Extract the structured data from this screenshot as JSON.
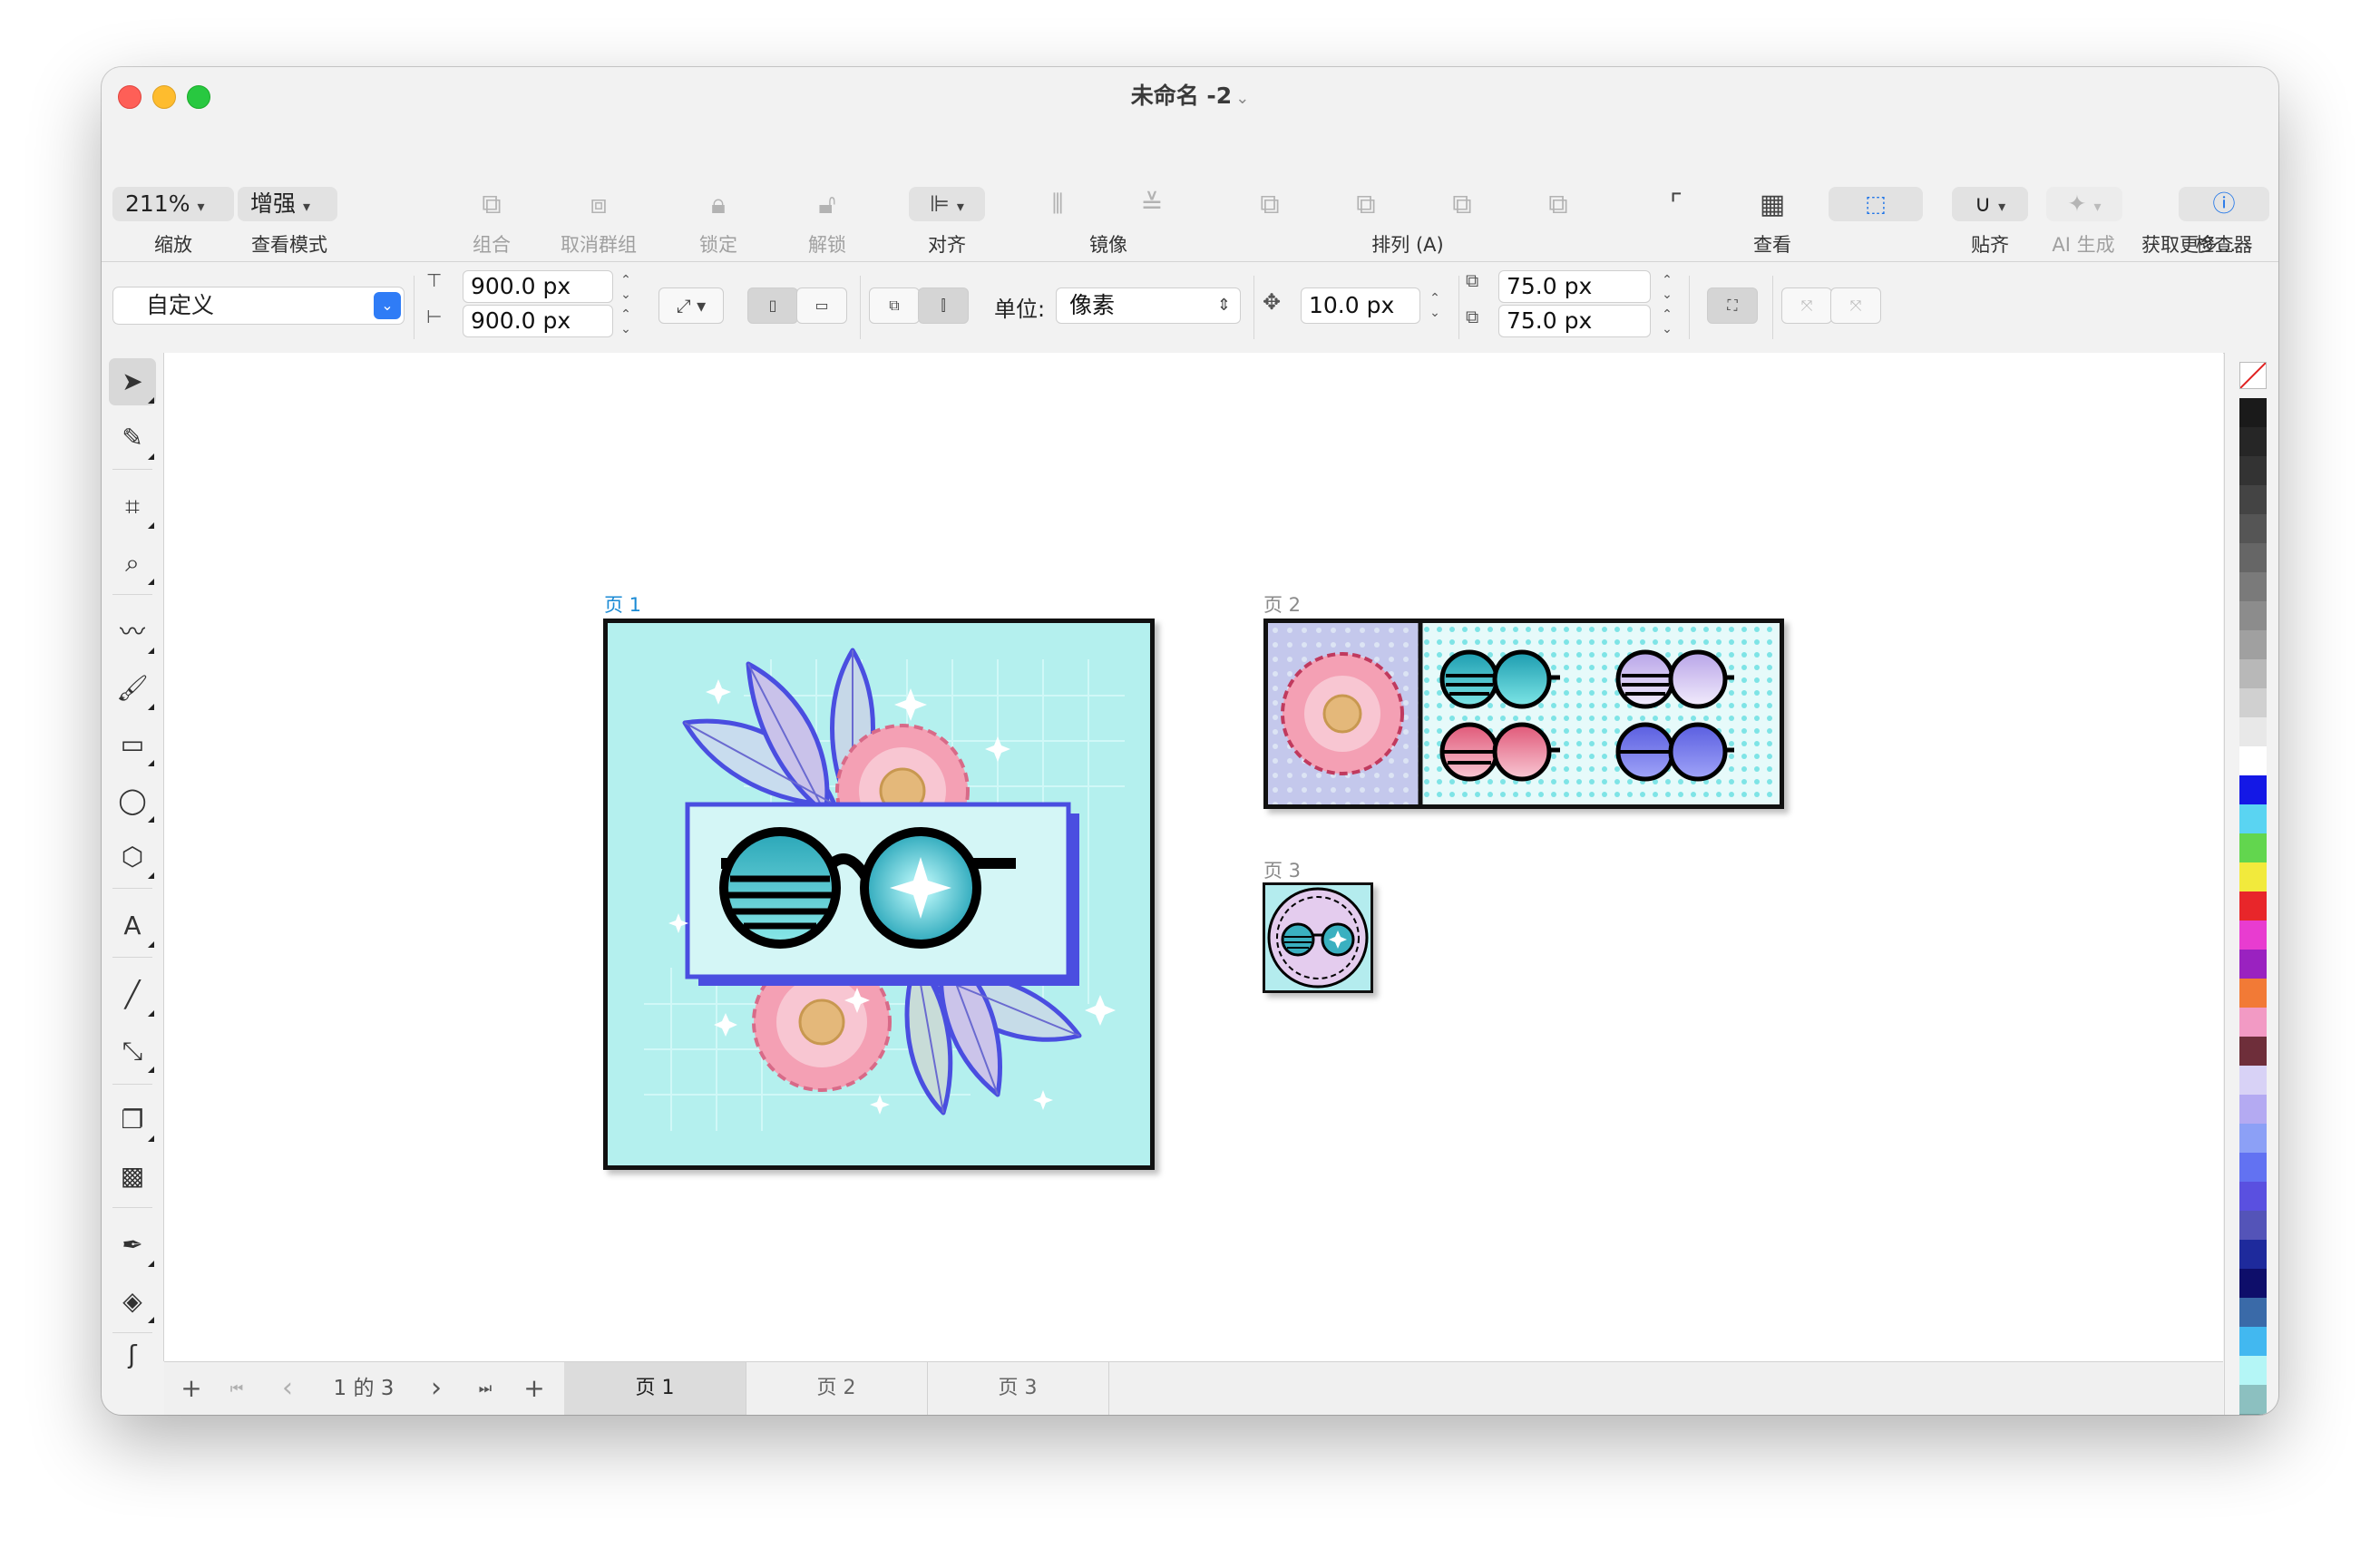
{
  "window": {
    "title": "未命名 -2",
    "title_chevron": "⌄"
  },
  "toolbar": {
    "zoom": {
      "value": "211%",
      "label": "缩放"
    },
    "view_mode": {
      "value": "增强",
      "label": "查看模式"
    },
    "group": {
      "label": "组合"
    },
    "ungroup": {
      "label": "取消群组"
    },
    "lock": {
      "label": "锁定"
    },
    "unlock": {
      "label": "解锁"
    },
    "align": {
      "label": "对齐"
    },
    "mirror": {
      "label": "镜像"
    },
    "arrange": {
      "label": "排列 (A)"
    },
    "view": {
      "label": "查看"
    },
    "snap": {
      "label": "贴齐"
    },
    "ai": {
      "label": "AI 生成"
    },
    "more": {
      "label": "获取更多..."
    },
    "inspector": {
      "label": "检查器"
    }
  },
  "propbar": {
    "preset": "自定义",
    "width": "900.0 px",
    "height": "900.0 px",
    "unit_label": "单位:",
    "unit_value": "像素",
    "nudge": "10.0 px",
    "dup_x": "75.0 px",
    "dup_y": "75.0 px"
  },
  "tools": [
    "pick-tool",
    "shape-tool",
    "crop-tool",
    "zoom-tool",
    "freehand-tool",
    "brush-tool",
    "rectangle-tool",
    "ellipse-tool",
    "polygon-tool",
    "text-tool",
    "line-tool",
    "connector-tool",
    "shadow-tool",
    "transparency-tool",
    "eyedropper-tool",
    "fill-tool",
    "smear-tool"
  ],
  "pages": {
    "page1_label": "页 1",
    "page2_label": "页 2",
    "page3_label": "页 3"
  },
  "pager": {
    "add_before": "+",
    "first": "⏮",
    "prev": "‹",
    "status": "1 的 3",
    "next": "›",
    "last": "⏭",
    "add_after": "+",
    "tabs": [
      "页 1",
      "页 2",
      "页 3"
    ]
  },
  "colors": {
    "accent": "#1a72e8",
    "page_bg": "#b4f0ee",
    "frame_blue": "#4a4ee0",
    "flower_pink": "#f4a0b4"
  },
  "palette": [
    "#1a1a1a",
    "#262626",
    "#333333",
    "#444444",
    "#555555",
    "#666666",
    "#7a7a7a",
    "#8c8c8c",
    "#a0a0a0",
    "#b8b8b8",
    "#d0d0d0",
    "#e8e8e8",
    "#ffffff",
    "#1418e6",
    "#5ad4f2",
    "#62d64e",
    "#f2ea3c",
    "#e8262a",
    "#e83cd0",
    "#9a22c0",
    "#f27a36",
    "#f29ac4",
    "#6e2e3a",
    "#d8d2f6",
    "#b4aaf2",
    "#8ca0f6",
    "#6272f2",
    "#5a50e0",
    "#5454b8",
    "#1e2a9c",
    "#0e0e6a",
    "#3a6aa8",
    "#42b8f0",
    "#b4f6f6",
    "#8cc0c0",
    "#6a9a9a",
    "#3e6a6a",
    "#1e4040",
    "#1e5a2e"
  ]
}
